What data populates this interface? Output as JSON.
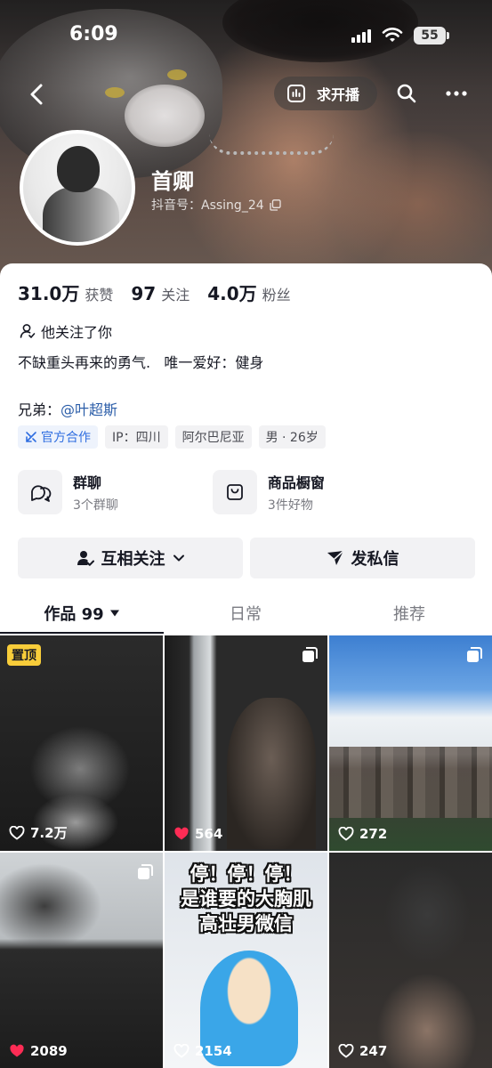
{
  "status_bar": {
    "time": "6:09",
    "battery": "55"
  },
  "nav": {
    "request_label": "求开播"
  },
  "profile": {
    "nickname": "首卿",
    "douyin_id": "抖音号：Assing_24"
  },
  "stats": [
    {
      "value": "31.0万",
      "label": "获赞"
    },
    {
      "value": "97",
      "label": "关注"
    },
    {
      "value": "4.0万",
      "label": "粉丝"
    }
  ],
  "follow_note": "他关注了你",
  "bio": "不缺重头再来的勇气.   唯一爱好：健身",
  "brother": {
    "prefix": "兄弟：",
    "link": "@叶超斯"
  },
  "tags": [
    "官方合作",
    "IP：四川",
    "阿尔巴尼亚",
    "男 · 26岁"
  ],
  "features": [
    {
      "title": "群聊",
      "sub": "3个群聊"
    },
    {
      "title": "商品橱窗",
      "sub": "3件好物"
    }
  ],
  "actions": {
    "follow": "互相关注",
    "message": "发私信"
  },
  "tabs": [
    {
      "label": "作品 99"
    },
    {
      "label": "日常"
    },
    {
      "label": "推荐"
    }
  ],
  "videos": [
    {
      "likes": "7.2万",
      "pinned": "置顶",
      "liked": false
    },
    {
      "likes": "564",
      "liked": true
    },
    {
      "likes": "272",
      "liked": false
    },
    {
      "likes": "2089",
      "liked": true
    },
    {
      "likes": "2154",
      "liked": false,
      "caption_1": "停！停！停！",
      "caption_2": "是谁要的大胸肌",
      "caption_3": "高壮男微信"
    },
    {
      "likes": "247",
      "liked": false
    }
  ],
  "colors": {
    "accent_link": "#2c5ea9",
    "official_tag": "#2f6ee0",
    "pin_badge": "#f8cd3a",
    "liked_heart": "#fe2c55"
  }
}
